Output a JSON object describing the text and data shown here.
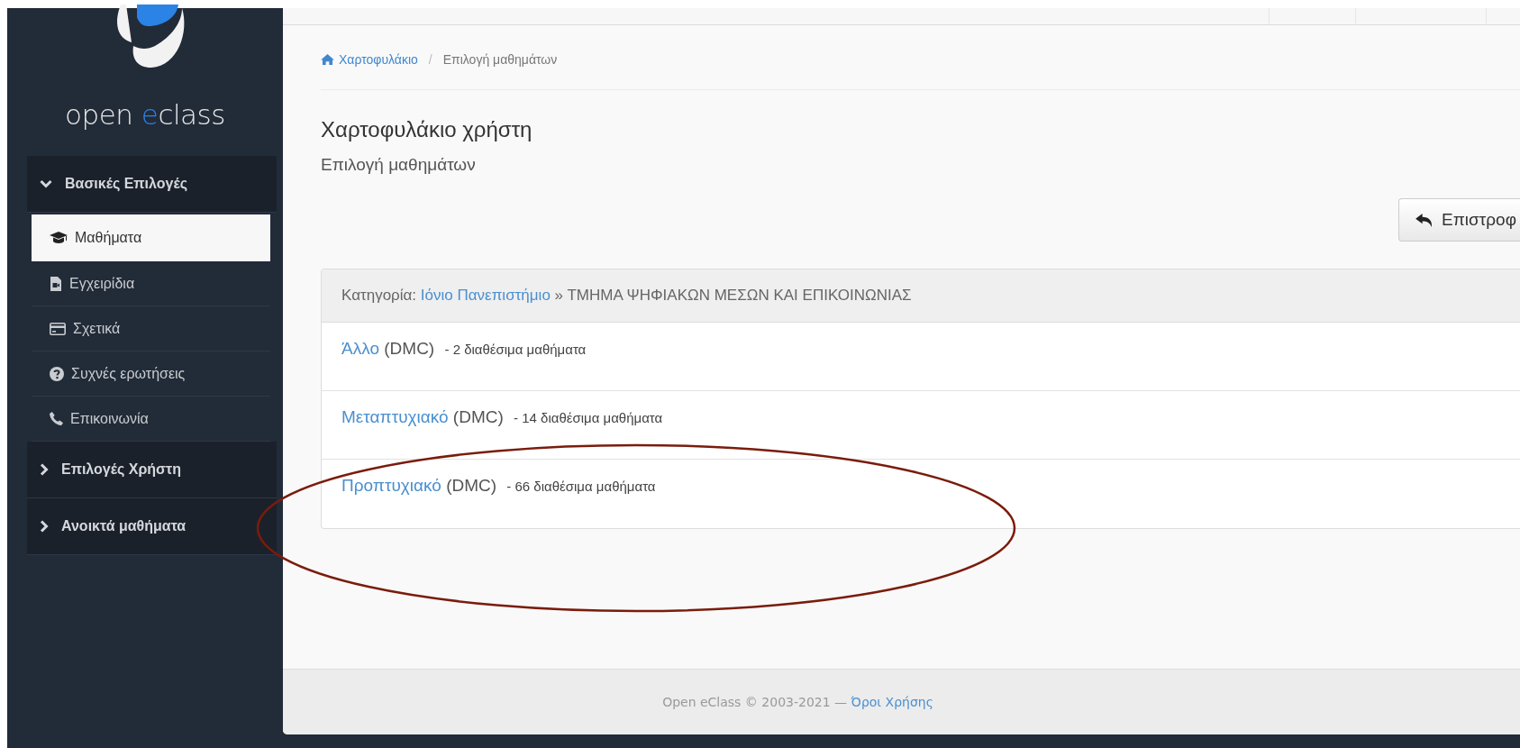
{
  "logo": {
    "before": "open ",
    "accent": "e",
    "after": "class"
  },
  "sidebar": {
    "sections": [
      {
        "label": "Βασικές Επιλογές",
        "expanded": true,
        "items": [
          {
            "label": "Μαθήματα",
            "selected": true
          },
          {
            "label": "Εγχειρίδια",
            "selected": false
          },
          {
            "label": "Σχετικά",
            "selected": false
          },
          {
            "label": "Συχνές ερωτήσεις",
            "selected": false
          },
          {
            "label": "Επικοινωνία",
            "selected": false
          }
        ]
      },
      {
        "label": "Επιλογές Χρήστη",
        "expanded": false
      },
      {
        "label": "Ανοικτά μαθήματα",
        "expanded": false
      }
    ]
  },
  "breadcrumb": [
    {
      "label": "Χαρτοφυλάκιο",
      "kind": "link"
    },
    {
      "label": "/",
      "kind": "separator"
    },
    {
      "label": "Επιλογή μαθημάτων",
      "kind": "current"
    }
  ],
  "title": "Χαρτοφυλάκιο χρήστη",
  "subtitle": "Επιλογή μαθημάτων",
  "back_button": "Επιστροφ",
  "panel": {
    "prefix": "Κατηγορία:",
    "link": "Ιόνιο Πανεπιστήμιο",
    "suffix": "» ΤΜΗΜΑ ΨΗΦΙΑΚΩΝ ΜΕΣΩΝ ΚΑΙ ΕΠΙΚΟΙΝΩΝΙΑΣ",
    "rows": [
      {
        "link": "Άλλο",
        "code": "(DMC)",
        "count": "-  2 διαθέσιμα μαθήματα"
      },
      {
        "link": "Μεταπτυχιακό",
        "code": "(DMC)",
        "count": "-  14 διαθέσιμα μαθήματα"
      },
      {
        "link": "Προπτυχιακό",
        "code": "(DMC)",
        "count": "-  66 διαθέσιμα μαθήματα"
      }
    ]
  },
  "footer": {
    "text": "Open eClass © 2003-2021 —",
    "link": "Όροι Χρήσης"
  }
}
